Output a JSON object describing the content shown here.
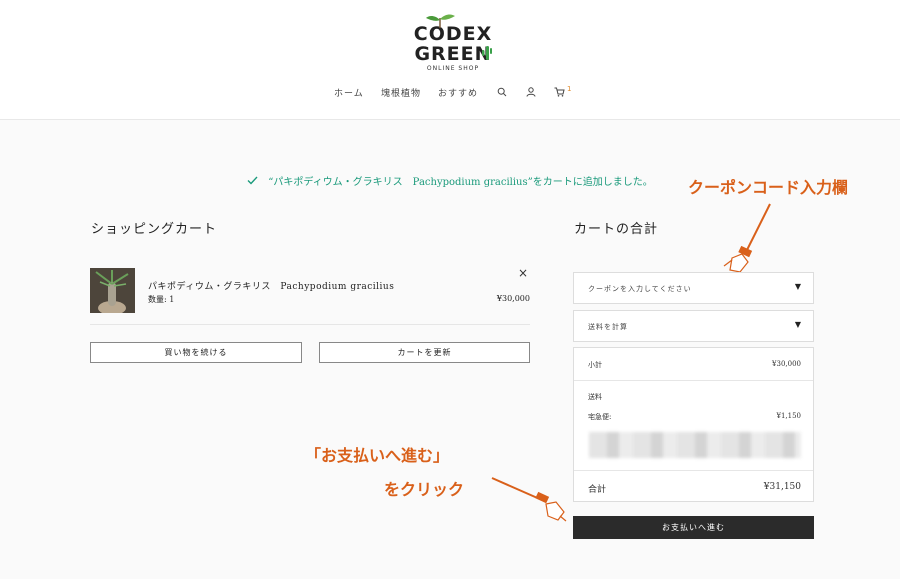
{
  "brand": {
    "line1": "CODEX",
    "line2": "GREEN",
    "line3": "ONLINE SHOP"
  },
  "nav": {
    "home": "ホーム",
    "caudex": "塊根植物",
    "recommend": "おすすめ",
    "cart_count": "1"
  },
  "notice": {
    "text": "“パキポディウム・グラキリス　Pachypodium gracilius”をカートに追加しました。"
  },
  "cart": {
    "title": "ショッピングカート",
    "item": {
      "name": "パキポディウム・グラキリス　Pachypodium gracilius",
      "qty": "数量: 1",
      "price": "¥30,000",
      "remove": "×"
    },
    "continue_label": "買い物を続ける",
    "update_label": "カートを更新"
  },
  "totals": {
    "title": "カートの合計",
    "coupon_placeholder": "クーポンを入力してください",
    "shipping_calc": "送料を計算",
    "subtotal_label": "小計",
    "subtotal_value": "¥30,000",
    "shipping_label": "送料",
    "shipping_method": "宅急便:",
    "shipping_value": "¥1,150",
    "total_label": "合計",
    "total_value": "¥31,150",
    "checkout_label": "お支払いへ進む"
  },
  "annotations": {
    "coupon": "クーポンコード入力欄",
    "checkout_line1": "「お支払いへ進む」",
    "checkout_line2": "をクリック"
  },
  "colors": {
    "accent_green": "#1a9a7b",
    "annotation_orange": "#d9601a",
    "checkout_bg": "#2b2b2b"
  }
}
